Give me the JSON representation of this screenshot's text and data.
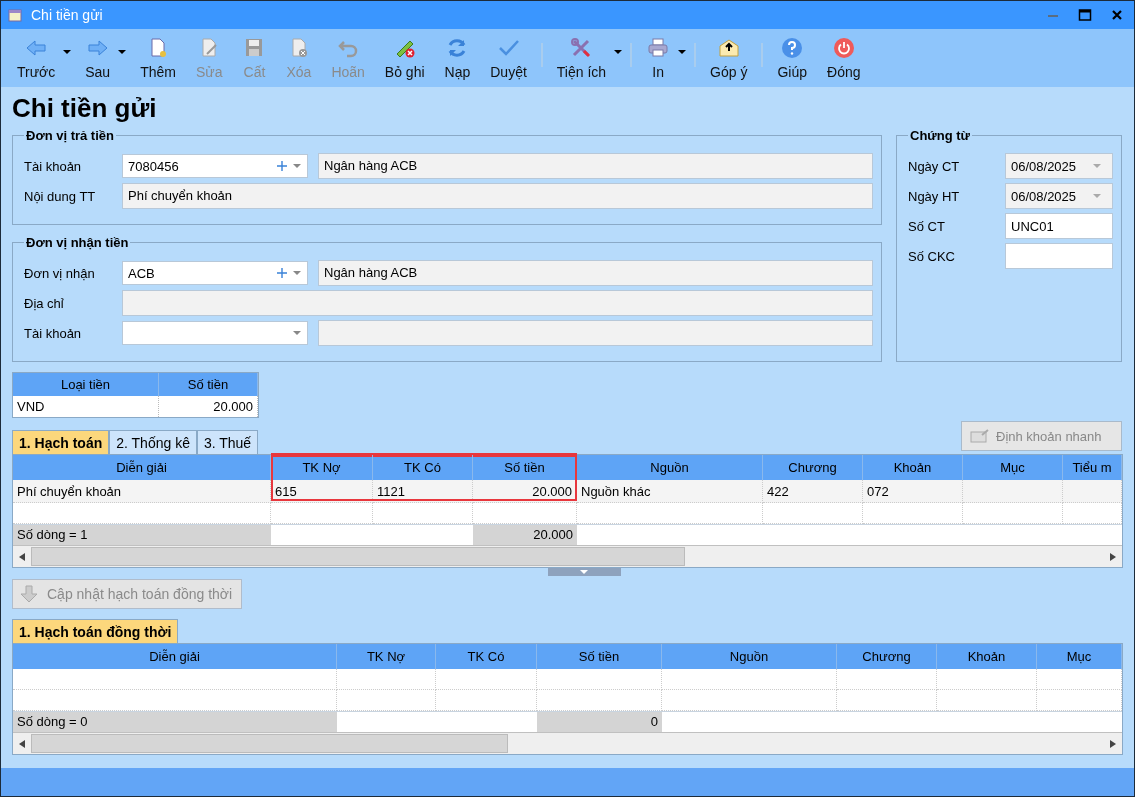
{
  "window": {
    "title": "Chi tiền gửi"
  },
  "toolbar": [
    [
      {
        "label": "Trước",
        "disabled": false,
        "dropdown": true
      },
      {
        "label": "Sau",
        "disabled": false,
        "dropdown": true
      },
      {
        "label": "Thêm",
        "disabled": false,
        "dropdown": false
      },
      {
        "label": "Sửa",
        "disabled": true,
        "dropdown": false
      },
      {
        "label": "Cất",
        "disabled": true,
        "dropdown": false
      },
      {
        "label": "Xóa",
        "disabled": true,
        "dropdown": false
      },
      {
        "label": "Hoãn",
        "disabled": true,
        "dropdown": false
      },
      {
        "label": "Bỏ ghi",
        "disabled": false,
        "dropdown": false
      },
      {
        "label": "Nạp",
        "disabled": false,
        "dropdown": false
      },
      {
        "label": "Duyệt",
        "disabled": false,
        "dropdown": false
      }
    ],
    [
      {
        "label": "Tiện ích",
        "disabled": false,
        "dropdown": true
      }
    ],
    [
      {
        "label": "In",
        "disabled": false,
        "dropdown": true
      }
    ],
    [
      {
        "label": "Góp ý",
        "disabled": false,
        "dropdown": false
      }
    ],
    [
      {
        "label": "Giúp",
        "disabled": false,
        "dropdown": false
      },
      {
        "label": "Đóng",
        "disabled": false,
        "dropdown": false
      }
    ]
  ],
  "heading": "Chi tiền gửi",
  "groups": [
    {
      "title": "Đơn vị trả tiền",
      "rows": [
        {
          "label": "Tài khoản",
          "kind": "combo",
          "value": "7080456",
          "add_button": true,
          "name": "Ngân hàng ACB"
        },
        {
          "label": "Nội dung TT",
          "kind": "text",
          "value": "Phí chuyển khoản"
        }
      ]
    },
    {
      "title": "Đơn vị nhận tiền",
      "rows": [
        {
          "label": "Đơn vị nhận",
          "kind": "combo",
          "value": "ACB",
          "add_button": true,
          "name": "Ngân hàng ACB"
        },
        {
          "label": "Địa chỉ",
          "kind": "text"
        },
        {
          "label": "Tài khoản",
          "kind": "combo",
          "add_button": false
        }
      ]
    }
  ],
  "voucher": {
    "title": "Chứng từ",
    "rows": [
      {
        "label": "Ngày CT",
        "kind": "date",
        "value": "06/08/2025"
      },
      {
        "label": "Ngày HT",
        "kind": "date",
        "value": "06/08/2025"
      },
      {
        "label": "Số CT",
        "kind": "text",
        "value": "UNC01"
      },
      {
        "label": "Số CKC",
        "kind": "text"
      }
    ]
  },
  "currency_table": {
    "columns": [
      "Loại tiền",
      "Số tiền"
    ],
    "rows": [
      [
        "VND",
        "20.000"
      ]
    ]
  },
  "tabs": [
    {
      "label": "1. Hạch toán",
      "selected": true
    },
    {
      "label": "2. Thống kê",
      "selected": false
    },
    {
      "label": "3. Thuế",
      "selected": false
    }
  ],
  "quick_entry_button": {
    "label": "Định khoản nhanh",
    "disabled": true
  },
  "entries_grid": {
    "columns": [
      {
        "label": "Diễn giải",
        "highlighted": false
      },
      {
        "label": "TK Nợ",
        "highlighted": true
      },
      {
        "label": "TK Có",
        "highlighted": true
      },
      {
        "label": "Số tiền",
        "highlighted": true
      },
      {
        "label": "Nguồn",
        "highlighted": false
      },
      {
        "label": "Chương",
        "highlighted": false
      },
      {
        "label": "Khoản",
        "highlighted": false
      },
      {
        "label": "Mục",
        "highlighted": false
      },
      {
        "label": "Tiểu m",
        "highlighted": false
      }
    ],
    "rows": [
      [
        "Phí chuyển khoản",
        "615",
        "1121",
        "20.000",
        "Nguồn khác",
        "422",
        "072",
        "",
        ""
      ]
    ],
    "footer": {
      "count": "Số dòng = 1",
      "total": "20.000"
    }
  },
  "update_button": {
    "label": "Cập nhật hạch toán đồng thời",
    "disabled": true
  },
  "tabs2": [
    {
      "label": "1. Hạch toán đồng thời",
      "selected": true
    }
  ],
  "parallel_grid": {
    "columns": [
      {
        "label": "Diễn giải",
        "highlighted": false
      },
      {
        "label": "TK Nợ",
        "highlighted": false
      },
      {
        "label": "TK Có",
        "highlighted": false
      },
      {
        "label": "Số tiền",
        "highlighted": false
      },
      {
        "label": "Nguồn",
        "highlighted": false
      },
      {
        "label": "Chương",
        "highlighted": false
      },
      {
        "label": "Khoản",
        "highlighted": false
      },
      {
        "label": "Mục",
        "highlighted": false
      }
    ],
    "footer": {
      "count": "Số dòng = 0",
      "total": "0"
    }
  }
}
